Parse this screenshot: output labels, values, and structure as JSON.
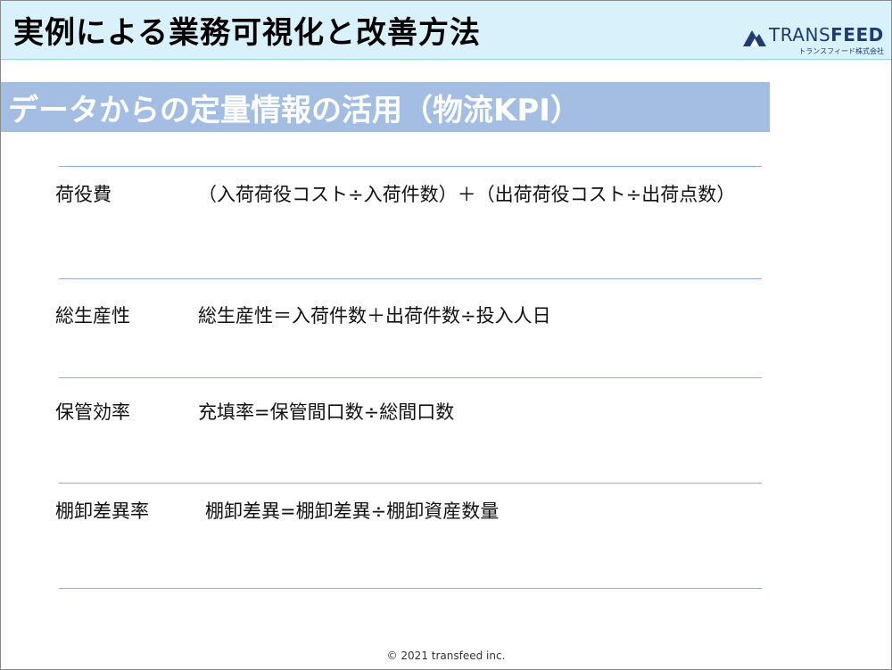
{
  "header": {
    "title": "実例による業務可視化と改善方法",
    "logo_text_bold": "TRANS",
    "logo_text_rest": "FEED",
    "logo_subtitle": "トランスフィード株式会社"
  },
  "section": {
    "title": "データからの定量情報の活用（物流KPI）"
  },
  "kpis": [
    {
      "label": "荷役費",
      "formula": "（入荷荷役コスト÷入荷件数）＋（出荷荷役コスト÷出荷点数）"
    },
    {
      "label": "総生産性",
      "formula": "総生産性＝入荷件数＋出荷件数÷投入人日"
    },
    {
      "label": "保管効率",
      "formula": "充填率=保管間口数÷総間口数"
    },
    {
      "label": "棚卸差異率",
      "formula": "棚卸差異=棚卸差異÷棚卸資産数量"
    }
  ],
  "footer": {
    "copyright": "© 2021 transfeed inc."
  },
  "colors": {
    "header_bg": "#d9f1fb",
    "section_band": "#a3bde3",
    "rule": "#8fb0dc",
    "logo": "#1f3b73"
  }
}
